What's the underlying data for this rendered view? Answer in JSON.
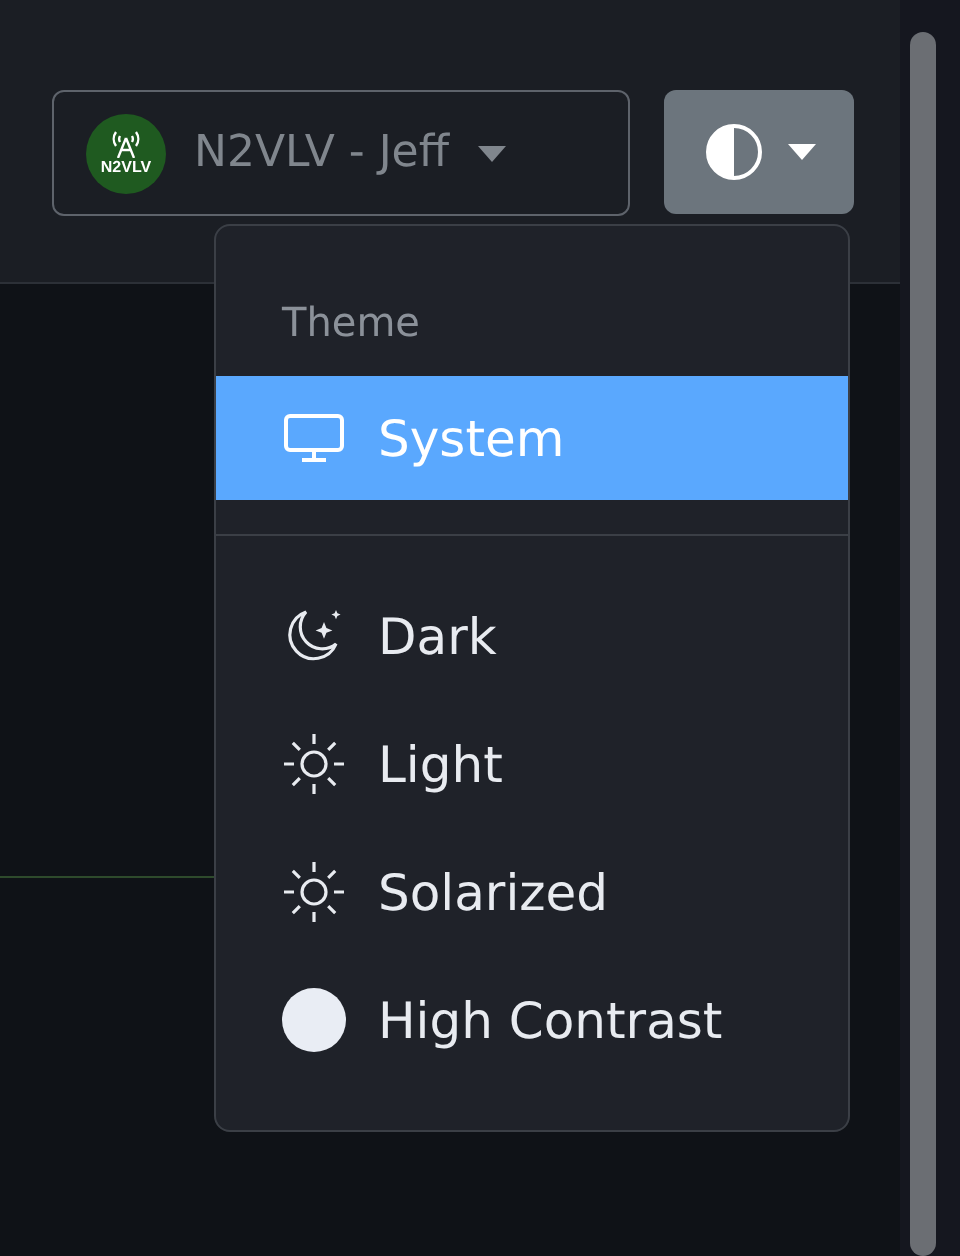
{
  "user_menu": {
    "avatar_text": "N2VLV",
    "label": "N2VLV - Jeff"
  },
  "theme_menu": {
    "expanded": true,
    "header": "Theme",
    "items": [
      {
        "label": "System",
        "kind": "monitor",
        "selected": true,
        "divider_after": true
      },
      {
        "label": "Dark",
        "kind": "moon",
        "selected": false
      },
      {
        "label": "Light",
        "kind": "sun",
        "selected": false
      },
      {
        "label": "Solarized",
        "kind": "sun",
        "selected": false
      },
      {
        "label": "High Contrast",
        "kind": "circle",
        "selected": false
      }
    ]
  }
}
